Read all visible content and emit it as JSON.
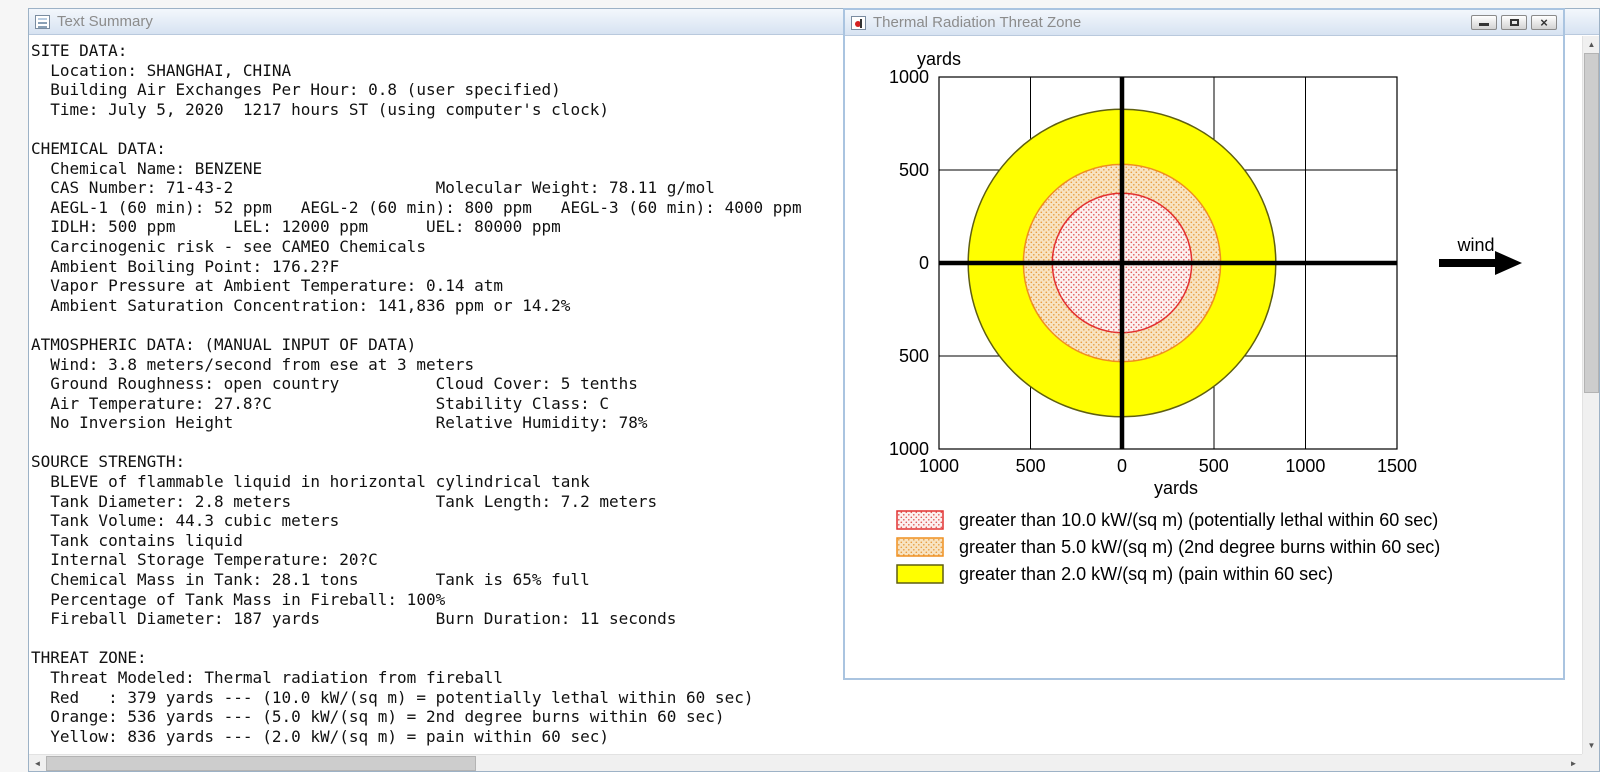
{
  "text_summary_window": {
    "title": "Text Summary",
    "lines": [
      "SITE DATA:",
      "  Location: SHANGHAI, CHINA",
      "  Building Air Exchanges Per Hour: 0.8 (user specified)",
      "  Time: July 5, 2020  1217 hours ST (using computer's clock)",
      "",
      "CHEMICAL DATA:",
      "  Chemical Name: BENZENE",
      "  CAS Number: 71-43-2                     Molecular Weight: 78.11 g/mol",
      "  AEGL-1 (60 min): 52 ppm   AEGL-2 (60 min): 800 ppm   AEGL-3 (60 min): 4000 ppm",
      "  IDLH: 500 ppm      LEL: 12000 ppm      UEL: 80000 ppm",
      "  Carcinogenic risk - see CAMEO Chemicals",
      "  Ambient Boiling Point: 176.2?F",
      "  Vapor Pressure at Ambient Temperature: 0.14 atm",
      "  Ambient Saturation Concentration: 141,836 ppm or 14.2%",
      "",
      "ATMOSPHERIC DATA: (MANUAL INPUT OF DATA)",
      "  Wind: 3.8 meters/second from ese at 3 meters",
      "  Ground Roughness: open country          Cloud Cover: 5 tenths",
      "  Air Temperature: 27.8?C                 Stability Class: C",
      "  No Inversion Height                     Relative Humidity: 78%",
      "",
      "SOURCE STRENGTH:",
      "  BLEVE of flammable liquid in horizontal cylindrical tank",
      "  Tank Diameter: 2.8 meters               Tank Length: 7.2 meters",
      "  Tank Volume: 44.3 cubic meters",
      "  Tank contains liquid",
      "  Internal Storage Temperature: 20?C",
      "  Chemical Mass in Tank: 28.1 tons        Tank is 65% full",
      "  Percentage of Tank Mass in Fireball: 100%",
      "  Fireball Diameter: 187 yards            Burn Duration: 11 seconds",
      "",
      "THREAT ZONE:",
      "  Threat Modeled: Thermal radiation from fireball",
      "  Red   : 379 yards --- (10.0 kW/(sq m) = potentially lethal within 60 sec)",
      "  Orange: 536 yards --- (5.0 kW/(sq m) = 2nd degree burns within 60 sec)",
      "  Yellow: 836 yards --- (2.0 kW/(sq m) = pain within 60 sec)"
    ]
  },
  "threat_window": {
    "title": "Thermal Radiation Threat Zone",
    "plot": {
      "y_axis_label": "yards",
      "x_axis_label": "yards",
      "wind_label": "wind",
      "y_ticks": [
        "1000",
        "500",
        "0",
        "500",
        "1000"
      ],
      "x_ticks": [
        "1000",
        "500",
        "0",
        "500",
        "1000",
        "1500"
      ]
    }
  },
  "chart_data": {
    "type": "threat_zone_rings",
    "title": "Thermal Radiation Threat Zone",
    "units": "yards",
    "x_axis": {
      "label": "yards",
      "range": [
        -1000,
        1500
      ],
      "tick_step": 500
    },
    "y_axis": {
      "label": "yards",
      "range": [
        -1000,
        1000
      ],
      "tick_step": 500
    },
    "center": [
      0,
      0
    ],
    "grid": true,
    "wind": {
      "label": "wind",
      "arrow_direction": "right"
    },
    "zones": [
      {
        "name": "red",
        "radius_yards": 379,
        "threshold": "10.0 kW/(sq m)",
        "effect": "potentially lethal within 60 sec",
        "legend_label": "greater than 10.0 kW/(sq m) (potentially lethal within 60 sec)",
        "stroke": "#e23030",
        "fill": "url(#red-dots)"
      },
      {
        "name": "orange",
        "radius_yards": 536,
        "threshold": "5.0 kW/(sq m)",
        "effect": "2nd degree burns within 60 sec",
        "legend_label": "greater than 5.0 kW/(sq m) (2nd degree burns within 60 sec)",
        "stroke": "#ef8f1f",
        "fill": "url(#orange-dots)"
      },
      {
        "name": "yellow",
        "radius_yards": 836,
        "threshold": "2.0 kW/(sq m)",
        "effect": "pain within 60 sec",
        "legend_label": "greater than 2.0 kW/(sq m) (pain within 60 sec)",
        "stroke": "#5f5f10",
        "fill": "#ffff00"
      }
    ]
  },
  "icons": {
    "close": "×",
    "scroll_up": "▲",
    "scroll_down": "▼",
    "scroll_left": "◄",
    "scroll_right": "►"
  }
}
